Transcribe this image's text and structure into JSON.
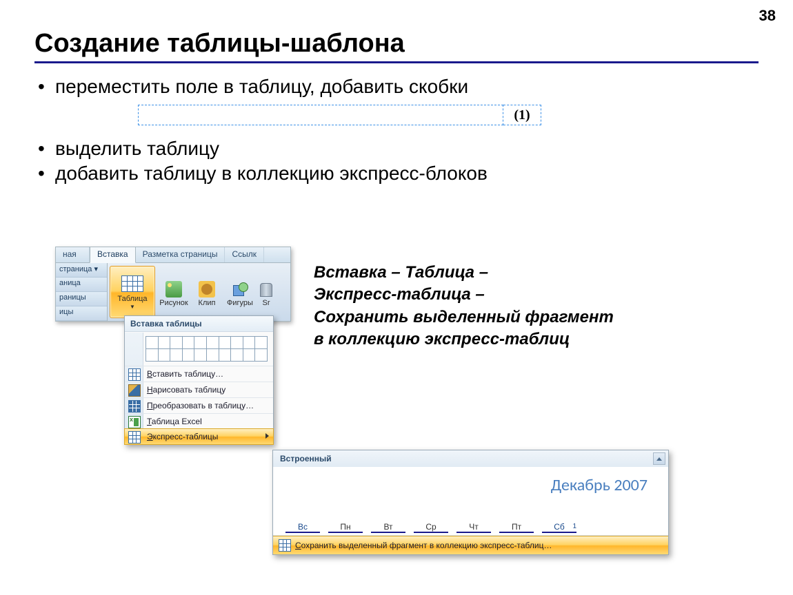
{
  "page_number": "38",
  "title": "Создание таблицы-шаблона",
  "bullets": {
    "b1": "переместить поле в таблицу, добавить скобки",
    "b2": "выделить таблицу",
    "b3": "добавить таблицу в коллекцию экспресс-блоков"
  },
  "field_value": "(1)",
  "ribbon": {
    "tabs": {
      "prev_cut": "ная",
      "active": "Вставка",
      "layout": "Разметка страницы",
      "refs": "Ссылк"
    },
    "side": {
      "s1": "страница ▾",
      "s2": "аница",
      "s3": "раницы",
      "s4": "ицы"
    },
    "table_btn": "Таблица",
    "btn_pic": "Рисунок",
    "btn_clip": "Клип",
    "btn_shapes": "Фигуры",
    "btn_smart": "Sr"
  },
  "dropdown": {
    "title": "Вставка таблицы",
    "items": {
      "insert": "Вставить таблицу…",
      "insert_u": "В",
      "draw": "Нарисовать таблицу",
      "draw_u": "Н",
      "convert": "Преобразовать в таблицу…",
      "convert_u": "П",
      "excel": "Таблица Excel",
      "excel_u": "Т",
      "express": "Экспресс-таблицы",
      "express_u": "Э"
    }
  },
  "express": {
    "header": "Встроенный",
    "calendar_title": "Декабрь 2007",
    "days": [
      "Вс",
      "Пн",
      "Вт",
      "Ср",
      "Чт",
      "Пт",
      "Сб"
    ],
    "sat_num": "1",
    "footer_prefix": "С",
    "footer_rest": "охранить выделенный фрагмент в коллекцию экспресс-таблиц…"
  },
  "instruction": {
    "l1": "Вставка – Таблица –",
    "l2": "Экспресс-таблица –",
    "l3": "Сохранить выделенный фрагмент",
    "l4": "в коллекцию экспресс-таблиц"
  }
}
